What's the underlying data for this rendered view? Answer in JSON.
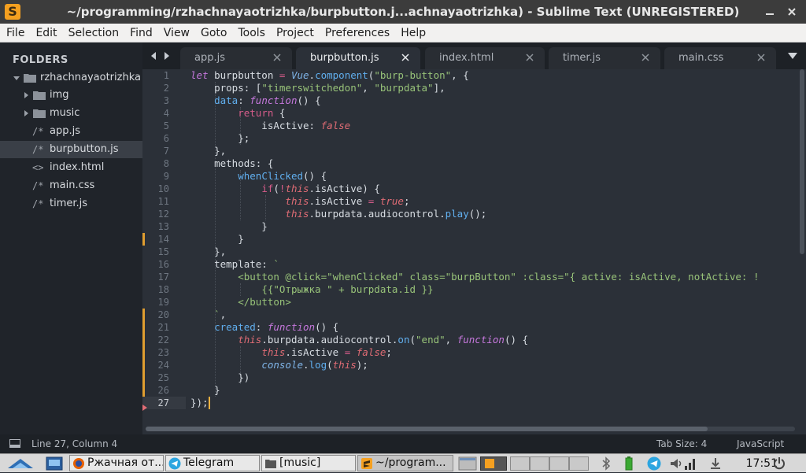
{
  "window": {
    "title": "~/programming/rzhachnayaotrizhka/burpbutton.j...achnayaotrizhka) - Sublime Text (UNREGISTERED)",
    "app_icon_glyph": "S"
  },
  "menu": [
    "File",
    "Edit",
    "Selection",
    "Find",
    "View",
    "Goto",
    "Tools",
    "Project",
    "Preferences",
    "Help"
  ],
  "sidebar": {
    "title": "FOLDERS",
    "items": [
      {
        "label": "rzhachnayaotrizhka",
        "kind": "folder-open"
      },
      {
        "label": "img",
        "kind": "folder"
      },
      {
        "label": "music",
        "kind": "folder"
      },
      {
        "label": "app.js",
        "kind": "file",
        "type": "/*"
      },
      {
        "label": "burpbutton.js",
        "kind": "file",
        "type": "/*",
        "selected": true
      },
      {
        "label": "index.html",
        "kind": "file",
        "type": "<>"
      },
      {
        "label": "main.css",
        "kind": "file",
        "type": "/*"
      },
      {
        "label": "timer.js",
        "kind": "file",
        "type": "/*"
      }
    ]
  },
  "tabs": [
    {
      "label": "app.js"
    },
    {
      "label": "burpbutton.js",
      "active": true
    },
    {
      "label": "index.html"
    },
    {
      "label": "timer.js"
    },
    {
      "label": "main.css"
    }
  ],
  "editor": {
    "line_numbers": [
      "1",
      "2",
      "3",
      "4",
      "5",
      "6",
      "7",
      "8",
      "9",
      "10",
      "11",
      "12",
      "13",
      "14",
      "15",
      "16",
      "17",
      "18",
      "19",
      "20",
      "21",
      "22",
      "23",
      "24",
      "25",
      "26",
      "27"
    ],
    "current_line": 27
  },
  "status": {
    "position": "Line 27, Column 4",
    "tab_size": "Tab Size: 4",
    "syntax": "JavaScript"
  },
  "taskbar": {
    "tasks": [
      {
        "label": "Ржачная от..."
      },
      {
        "label": "Telegram"
      },
      {
        "label": "[music]"
      },
      {
        "label": "~/program...",
        "active": true
      }
    ],
    "clock": "17:51"
  },
  "colors": {
    "editor_bg": "#2b3038",
    "sidebar_bg": "#20242a",
    "accent": "#f5a020",
    "keyword": "#c678dd",
    "string": "#98c379",
    "function": "#61afef"
  }
}
